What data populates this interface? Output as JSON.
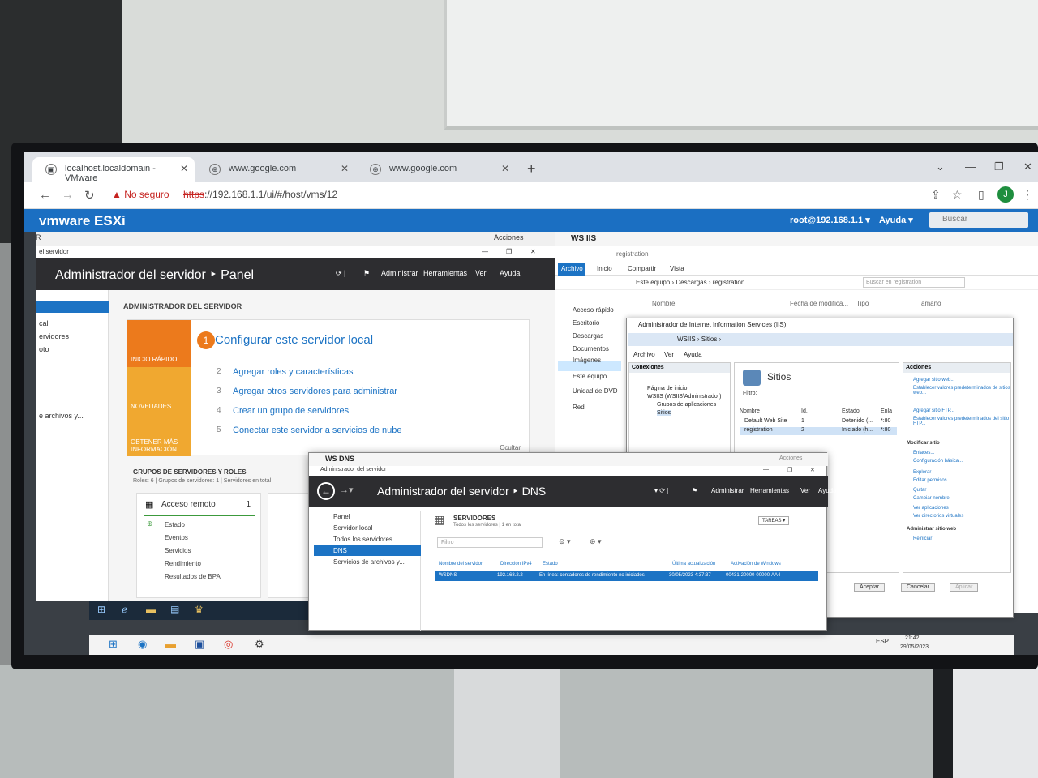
{
  "browser": {
    "tabs": [
      {
        "title": "localhost.localdomain - VMware",
        "active": true
      },
      {
        "title": "www.google.com",
        "active": false
      },
      {
        "title": "www.google.com",
        "active": false
      }
    ],
    "security_warning": "No seguro",
    "url_scheme": "https",
    "url_rest": "://192.168.1.1/ui/#/host/vms/12",
    "avatar_letter": "J"
  },
  "esxi": {
    "logo": "vmware ESXi",
    "user": "root@192.168.1.1 ▾",
    "help": "Ayuda ▾",
    "search_placeholder": "Buscar"
  },
  "vm1": {
    "actions": "Acciones",
    "window_title": "el servidor",
    "header_title": "Administrador del servidor ‣ Panel",
    "menu": [
      "Administrar",
      "Herramientas",
      "Ver",
      "Ayuda"
    ],
    "sidebar": [
      "cal",
      "ervidores",
      "oto",
      "e archivos y..."
    ],
    "section_title": "ADMINISTRADOR DEL SERVIDOR",
    "quickstart": {
      "boxes": [
        "INICIO RÁPIDO",
        "NOVEDADES",
        "OBTENER MÁS INFORMACIÓN"
      ],
      "main_step_num": "1",
      "main_step": "Configurar este servidor local",
      "steps": [
        {
          "num": "2",
          "label": "Agregar roles y características"
        },
        {
          "num": "3",
          "label": "Agregar otros servidores para administrar"
        },
        {
          "num": "4",
          "label": "Crear un grupo de servidores"
        },
        {
          "num": "5",
          "label": "Conectar este servidor a servicios de nube"
        }
      ],
      "hide": "Ocultar"
    },
    "groups_title": "GRUPOS DE SERVIDORES Y ROLES",
    "groups_sub": "Roles: 6  |  Grupos de servidores: 1  |  Servidores en total",
    "tile": {
      "title": "Acceso remoto",
      "count": "1",
      "items": [
        "Estado",
        "Eventos",
        "Servicios",
        "Rendimiento",
        "Resultados de BPA"
      ]
    }
  },
  "vm2": {
    "title": "WS IIS",
    "explorer": {
      "title": "registration",
      "ribbon": [
        "Archivo",
        "Inicio",
        "Compartir",
        "Vista"
      ],
      "breadcrumb": "Este equipo  ›  Descargas  ›  registration",
      "search_placeholder": "Buscar en registration",
      "columns": [
        "Nombre",
        "Fecha de modifica...",
        "Tipo",
        "Tamaño"
      ],
      "nav": [
        "Acceso rápido",
        "Escritorio",
        "Descargas",
        "Documentos",
        "Imágenes",
        "Este equipo",
        "Unidad de DVD",
        "Red"
      ]
    },
    "iis": {
      "title": "Administrador de Internet Information Services (IIS)",
      "address": "WSIIS  ›  Sitios  ›",
      "menu": [
        "Archivo",
        "Ver",
        "Ayuda"
      ],
      "connections_header": "Conexiones",
      "tree": [
        "Página de inicio",
        "WSIIS (WSIIS\\Administrador)",
        "Grupos de aplicaciones",
        "Sitios"
      ],
      "sites_title": "Sitios",
      "filter_label": "Filtro:",
      "columns": [
        "Nombre",
        "Id.",
        "Estado",
        "Enla"
      ],
      "rows": [
        {
          "name": "Default Web Site",
          "id": "1",
          "state": "Detenido (...",
          "binding": "*:80"
        },
        {
          "name": "registration",
          "id": "2",
          "state": "Iniciado (h...",
          "binding": "*:80"
        }
      ],
      "actions_header": "Acciones",
      "actions": [
        "Agregar sitio web...",
        "Establecer valores predeterminados de sitios web...",
        "Agregar sitio FTP...",
        "Establecer valores predeterminados del sitio FTP..."
      ],
      "modify_header": "Modificar sitio",
      "modify_items": [
        "Enlaces...",
        "Configuración básica...",
        "Explorar",
        "Editar permisos...",
        "Quitar",
        "Cambiar nombre",
        "Ver aplicaciones",
        "Ver directorios virtuales"
      ],
      "admin_header": "Administrar sitio web",
      "restart": "Reiniciar",
      "buttons": [
        "Aceptar",
        "Cancelar",
        "Aplicar"
      ]
    }
  },
  "vm3": {
    "title": "WS DNS",
    "subtitle": "Administrador del servidor",
    "actions": "Acciones",
    "header_title": "Administrador del servidor ‣ DNS",
    "menu": [
      "Administrar",
      "Herramientas",
      "Ver",
      "Ayuda"
    ],
    "sidebar": [
      "Panel",
      "Servidor local",
      "Todos los servidores",
      "DNS",
      "Servicios de archivos y..."
    ],
    "servers_title": "SERVIDORES",
    "servers_sub": "Todos los servidores | 1 en total",
    "tasks": "TAREAS ▾",
    "filter_placeholder": "Filtro",
    "columns": [
      "Nombre del servidor",
      "Dirección IPv4",
      "Estado",
      "Última actualización",
      "Activación de Windows"
    ],
    "row": {
      "name": "WSDNS",
      "ip": "192.168.2.2",
      "status": "En línea: contadores de rendimiento no iniciados",
      "updated": "30/05/2023 4:37:37",
      "activation": "00431-20000-00000-AA4"
    }
  },
  "host_tray": {
    "lang": "ESP",
    "time": "21:42",
    "date": "29/05/2023"
  }
}
